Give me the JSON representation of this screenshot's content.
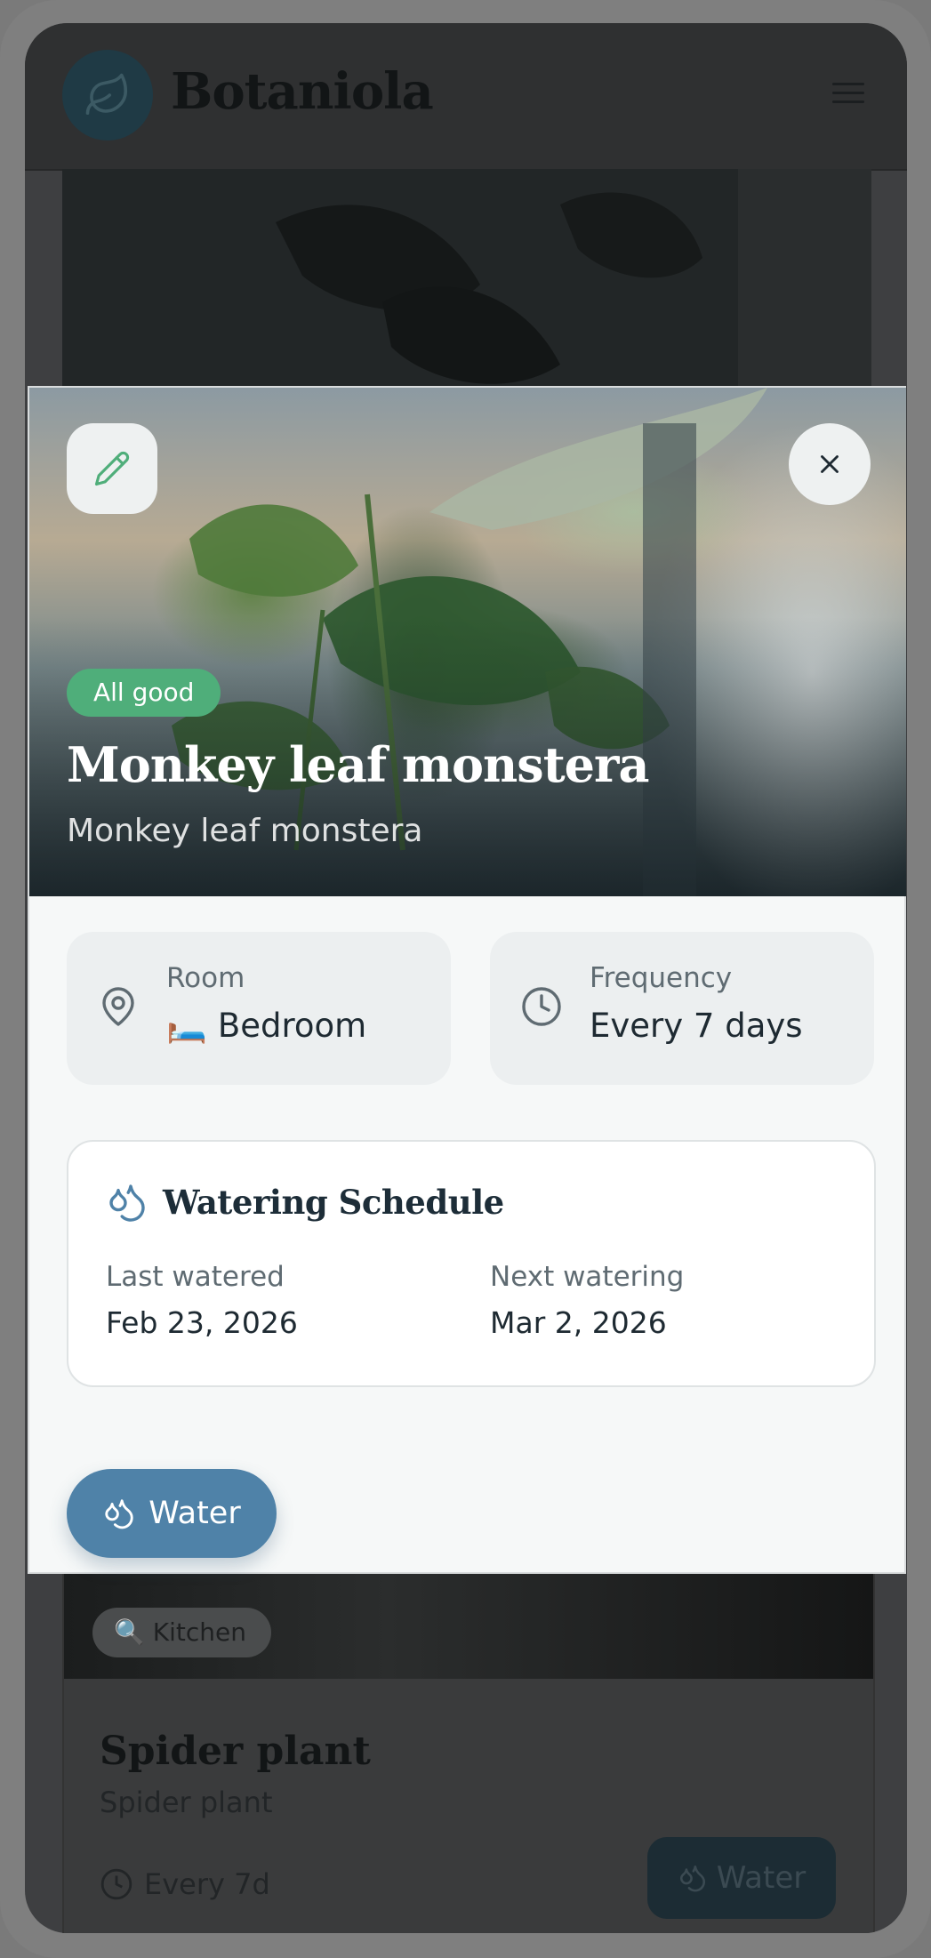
{
  "app": {
    "brand": "Botaniola"
  },
  "modal": {
    "status": "All good",
    "title": "Monkey leaf monstera",
    "subtitle": "Monkey leaf monstera",
    "room": {
      "label": "Room",
      "value": "🛏️ Bedroom"
    },
    "frequency": {
      "label": "Frequency",
      "value": "Every 7 days"
    },
    "schedule": {
      "title": "Watering Schedule",
      "last_label": "Last watered",
      "last_value": "Feb 23, 2026",
      "next_label": "Next watering",
      "next_value": "Mar 2, 2026"
    },
    "water_label": "Water"
  },
  "background_card": {
    "tag": "Kitchen",
    "title": "Spider plant",
    "subtitle": "Spider plant",
    "frequency": "Every 7d",
    "water_label": "Water"
  },
  "colors": {
    "accent": "#4f82a8",
    "status": "#4fae7a",
    "edit_icon": "#4fae7a"
  }
}
